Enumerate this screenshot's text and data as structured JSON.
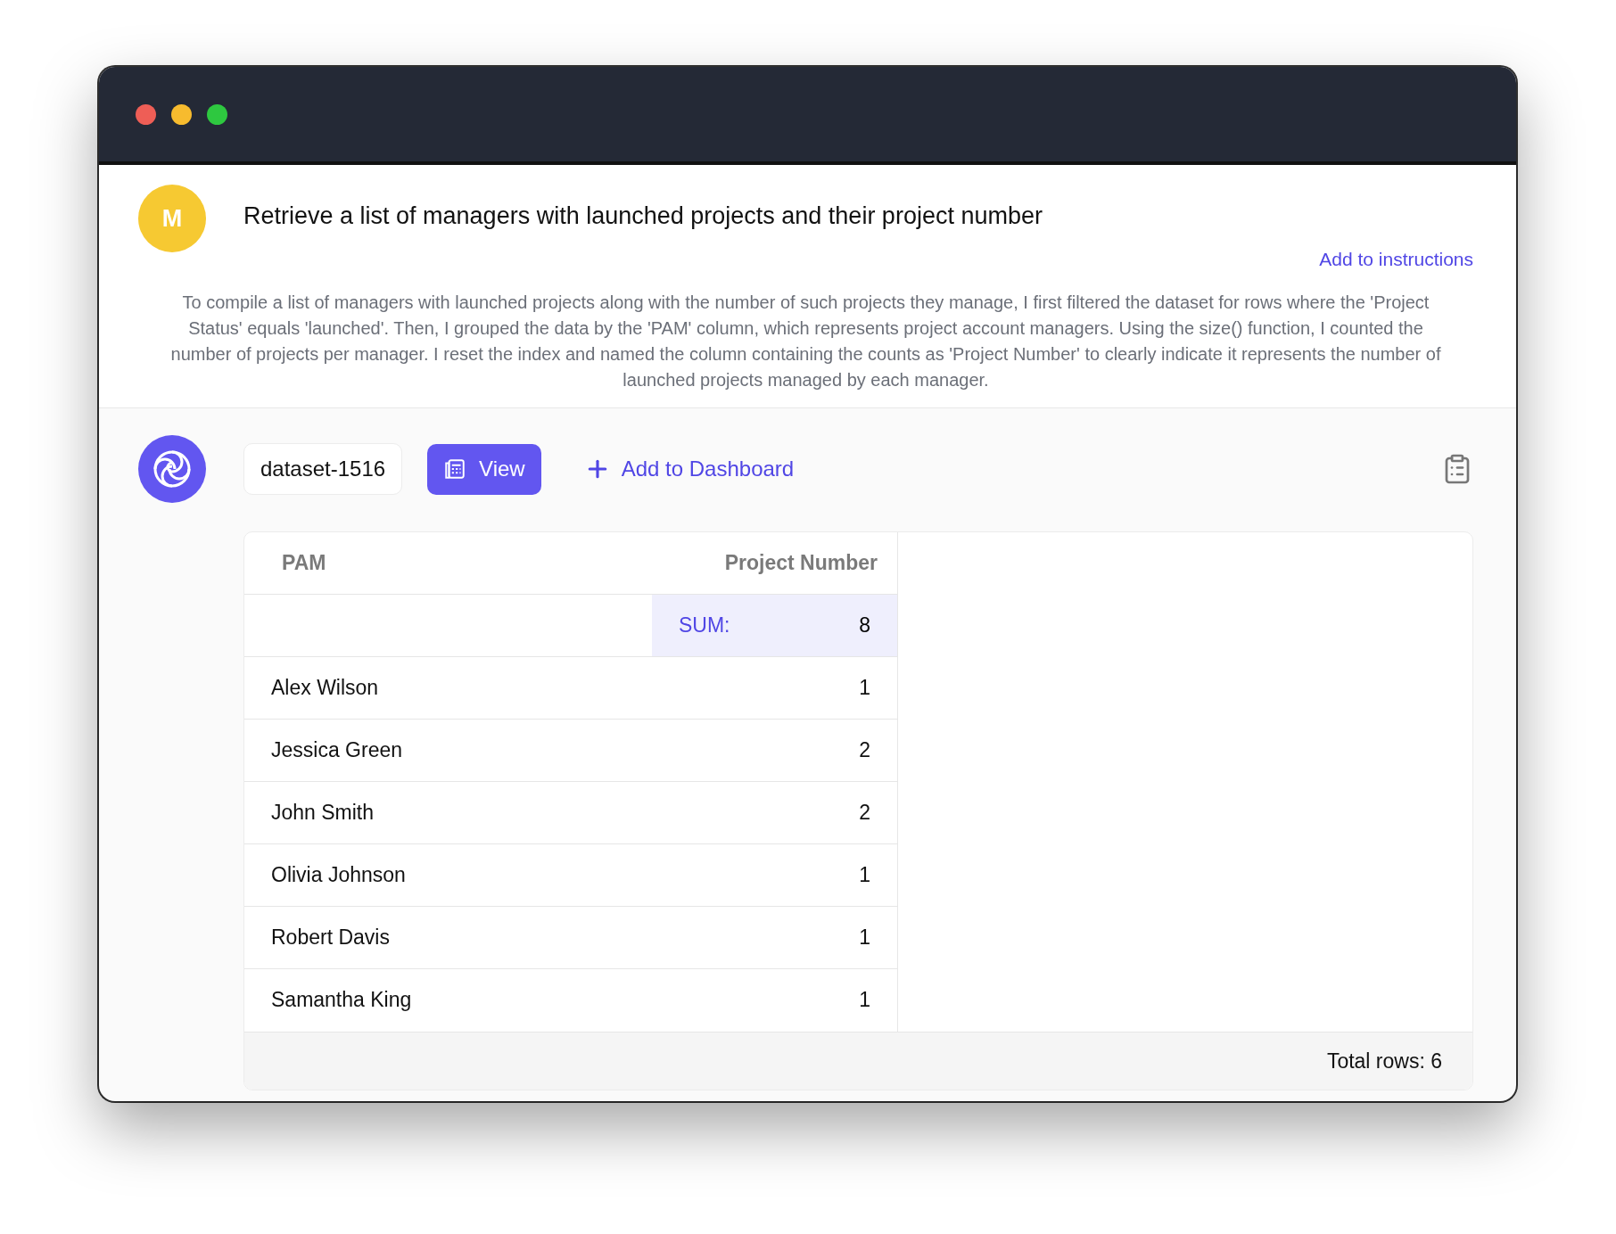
{
  "window": {
    "controls": [
      {
        "color": "#ee5e56"
      },
      {
        "color": "#f7bb2e"
      },
      {
        "color": "#2ec840"
      }
    ]
  },
  "question": {
    "avatar": "M",
    "text": "Retrieve a list of managers with launched projects and their project number",
    "link": "Add to instructions",
    "explanation": "To compile a list of managers with launched projects along with the number of such projects they manage, I first filtered the dataset for rows where the 'Project Status' equals 'launched'. Then, I grouped the data by the 'PAM' column, which represents project account managers. Using the size() function, I counted the number of projects per manager. I reset the index and named the column containing the counts as 'Project Number' to clearly indicate it represents the number of launched projects managed by each manager."
  },
  "answer": {
    "dataset": "dataset-1516",
    "view_button": "View",
    "add_button": "Add to Dashboard"
  },
  "table": {
    "columns": [
      "PAM",
      "Project Number"
    ],
    "sum_label": "SUM:",
    "sum_value": "8",
    "rows": [
      [
        "Alex Wilson",
        "1"
      ],
      [
        "Jessica Green",
        "2"
      ],
      [
        "John Smith",
        "2"
      ],
      [
        "Olivia Johnson",
        "1"
      ],
      [
        "Robert Davis",
        "1"
      ],
      [
        "Samantha King",
        "1"
      ]
    ],
    "footer": "Total rows: 6"
  }
}
